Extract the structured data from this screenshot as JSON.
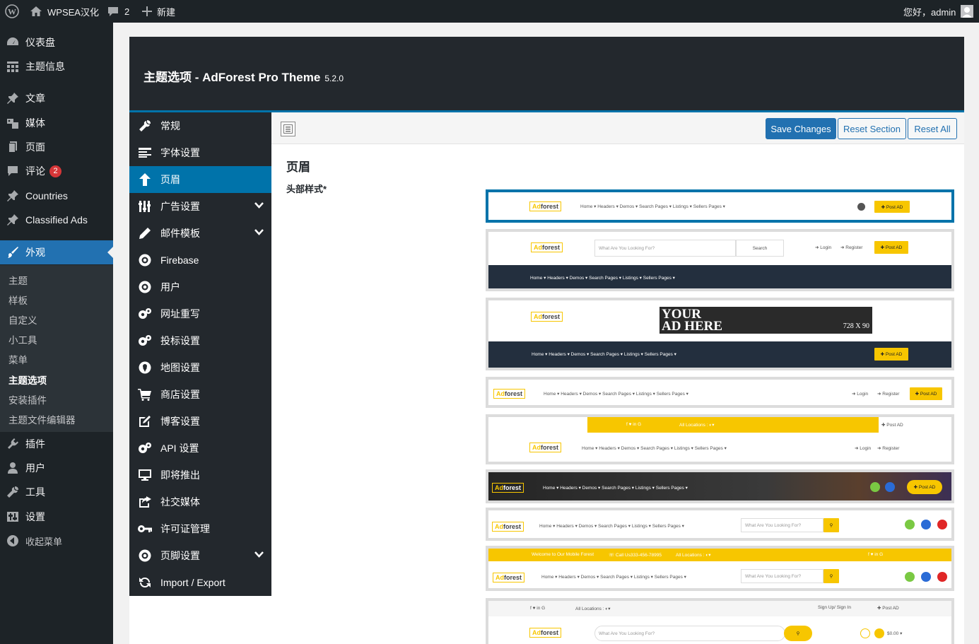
{
  "admin_bar": {
    "site_name": "WPSEA汉化",
    "comments_count": "2",
    "new_label": "新建",
    "greeting": "您好，admin"
  },
  "menu": {
    "dashboard": "仪表盘",
    "theme_info": "主题信息",
    "posts": "文章",
    "media": "媒体",
    "pages": "页面",
    "comments": "评论",
    "comments_badge": "2",
    "countries": "Countries",
    "classified_ads": "Classified Ads",
    "appearance": "外观",
    "appearance_sub": {
      "themes": "主题",
      "patterns": "样板",
      "customize": "自定义",
      "widgets": "小工具",
      "menus": "菜单",
      "theme_options": "主题选项",
      "install_plugins": "安装插件",
      "theme_file_editor": "主题文件编辑器"
    },
    "plugins": "插件",
    "users": "用户",
    "tools": "工具",
    "settings": "设置",
    "collapse": "收起菜单"
  },
  "panel": {
    "title": "主题选项 - AdForest Pro Theme",
    "version": "5.2.0",
    "nav": {
      "general": "常规",
      "typography": "字体设置",
      "header": "页眉",
      "ads_settings": "广告设置",
      "email_templates": "邮件模板",
      "firebase": "Firebase",
      "users": "用户",
      "url_rewrite": "网址重写",
      "bidding": "投标设置",
      "map": "地图设置",
      "shop": "商店设置",
      "blog": "博客设置",
      "api": "API 设置",
      "coming_soon": "即将推出",
      "social_media": "社交媒体",
      "license": "许可证管理",
      "footer": "页脚设置",
      "import_export": "Import / Export"
    },
    "buttons": {
      "save": "Save Changes",
      "reset_section": "Reset Section",
      "reset_all": "Reset All"
    },
    "section_title": "页眉",
    "field_label": "头部样式*"
  },
  "previews": {
    "logo_ad": "Ad",
    "logo_forest": "forest",
    "nav_a": "Home ▾   Headers ▾   Demos ▾   Search Pages ▾   Listings ▾   Sellers   Pages ▾",
    "nav_b": "Home ▾   Headers ▾   Demos ▾   Search Pages ▾   Listings ▾   Sellers   Pages ▾",
    "nav_c": "Home ▾   Headers ▾   Demos ▾   Search Pages ▾   Listings ▾   Sellers   Pages ▾",
    "nav_d": "Home ▾   Headers ▾   Demos ▾   Search Pages ▾   Listings ▾   Sellers   Pages ▾",
    "nav_e": "Home ▾   Headers ▾   Demos ▾   Search Pages ▾   Listings ▾   Sellers   Pages ▾",
    "nav_f": "Home ▾   Headers ▾   Demos ▾   Search Pages ▾   Listings ▾   Sellers   Pages ▾",
    "nav_g": "Home ▾   Headers ▾   Demos ▾   Search Pages ▾   Listings ▾   Sellers   Pages ▾",
    "nav_h": "Home ▾   Headers ▾   Demos ▾   Search Pages ▾   Listings ▾   Sellers   Pages ▾",
    "post_ad": "✚ Post AD",
    "search_placeholder": "What Are You Looking For?",
    "search_btn": "Search",
    "login": "➜ Login",
    "register": "➜ Register",
    "ad_your": "YOUR",
    "ad_here": "AD HERE",
    "ad_size": "728 X 90",
    "social": "f    ♥    in    G",
    "all_locations": "All Locations : ◐▾",
    "welcome": "Welcome to Our Mobile Forest",
    "call": "☏ Call Us333-456-78995",
    "signup": "Sign Up/ Sign In",
    "cart": "$0.00 ▾"
  },
  "colors": {
    "accent": "#2271b1",
    "adforest_yellow": "#f7c600",
    "admin_dark": "#1d2327"
  }
}
